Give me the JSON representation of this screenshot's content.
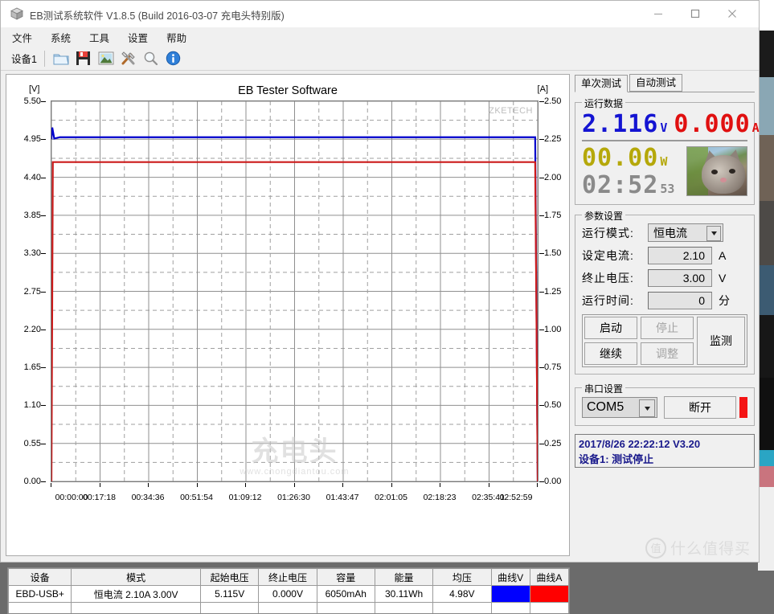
{
  "window": {
    "title": "EB测试系统软件 V1.8.5 (Build 2016-03-07 充电头特别版)",
    "minimize": "–",
    "maximize": "□",
    "close": "×"
  },
  "menu": {
    "items": [
      "文件",
      "系统",
      "工具",
      "设置",
      "帮助"
    ]
  },
  "toolbar": {
    "device_label": "设备1",
    "icons": [
      "open-folder-icon",
      "save-floppy-icon",
      "image-icon",
      "tools-icon",
      "zoom-icon",
      "info-icon"
    ]
  },
  "tabs": [
    {
      "label": "单次测试",
      "active": true
    },
    {
      "label": "自动测试",
      "active": false
    }
  ],
  "readout": {
    "group_title": "运行数据",
    "voltage": "2.116",
    "voltage_unit": "V",
    "current": "0.000",
    "current_unit": "A",
    "power": "00.00",
    "power_unit": "W",
    "time": "02:52",
    "time_unit": "53",
    "colors": {
      "voltage": "#1414d2",
      "current": "#e01010",
      "power": "#b5a80a",
      "time": "#8a8a8a"
    }
  },
  "params": {
    "group_title": "参数设置",
    "mode_label": "运行模式:",
    "mode_value": "恒电流",
    "current_label": "设定电流:",
    "current_value": "2.10",
    "current_unit": "A",
    "cutoff_label": "终止电压:",
    "cutoff_value": "3.00",
    "cutoff_unit": "V",
    "runtime_label": "运行时间:",
    "runtime_value": "0",
    "runtime_unit": "分",
    "buttons": [
      {
        "label": "启动",
        "disabled": false
      },
      {
        "label": "停止",
        "disabled": true
      },
      {
        "label": "继续",
        "disabled": false
      },
      {
        "label": "调整",
        "disabled": true
      }
    ],
    "monitor_label": "监测"
  },
  "serial": {
    "group_title": "串口设置",
    "port": "COM5",
    "disconnect_label": "断开",
    "led_color": "#f41414"
  },
  "log": {
    "line1": "2017/8/26 22:22:12  V3.20",
    "line2": "设备1: 测试停止"
  },
  "table": {
    "headers": [
      "设备",
      "模式",
      "起始电压",
      "终止电压",
      "容量",
      "能量",
      "均压",
      "曲线V",
      "曲线A"
    ],
    "rows": [
      {
        "device": "EBD-USB+",
        "mode": "恒电流  2.10A  3.00V",
        "start_v": "5.115V",
        "end_v": "0.000V",
        "capacity": "6050mAh",
        "energy": "30.11Wh",
        "avg_v": "4.98V",
        "curve_v_color": "#0000ff",
        "curve_a_color": "#ff0000"
      }
    ]
  },
  "watermarks": {
    "chart_corner": "ZKETECH",
    "center_big": "充电头",
    "center_url": "www.chongdiantou.com",
    "smzdm_badge": "值",
    "smzdm_text": "什么值得买"
  },
  "chart_data": {
    "type": "line",
    "title": "EB Tester Software",
    "xlabel": "",
    "ylabel": "[V]",
    "y2label": "[A]",
    "ylim": [
      0.0,
      5.5
    ],
    "y2lim": [
      0.0,
      2.5
    ],
    "grid": true,
    "legend": "none",
    "yticks": [
      "0.00",
      "0.55",
      "1.10",
      "1.65",
      "2.20",
      "2.75",
      "3.30",
      "3.85",
      "4.40",
      "4.95",
      "5.50"
    ],
    "y2ticks": [
      "0.00",
      "0.25",
      "0.50",
      "0.75",
      "1.00",
      "1.25",
      "1.50",
      "1.75",
      "2.00",
      "2.25",
      "2.50"
    ],
    "xticks": [
      "00:00:00",
      "00:17:18",
      "00:34:36",
      "00:51:54",
      "01:09:12",
      "01:26:30",
      "01:43:47",
      "02:01:05",
      "02:18:23",
      "02:35:41",
      "02:52:59"
    ],
    "series": [
      {
        "name": "Voltage",
        "axis": "left",
        "color": "#0000cc",
        "unit": "V",
        "x": [
          0,
          0.3,
          1.0,
          3.0,
          20,
          60,
          100,
          140,
          165,
          171,
          172,
          172.5,
          172.9
        ],
        "values": [
          4.95,
          5.12,
          4.96,
          4.98,
          4.98,
          4.98,
          4.98,
          4.98,
          4.98,
          4.98,
          4.98,
          2.3,
          0.0
        ]
      },
      {
        "name": "Current",
        "axis": "right",
        "color": "#cc1a1a",
        "unit": "A",
        "x": [
          0,
          0.5,
          2.0,
          20,
          60,
          100,
          140,
          165,
          171,
          172,
          172.5,
          172.9
        ],
        "values": [
          0.0,
          2.1,
          2.1,
          2.1,
          2.1,
          2.1,
          2.1,
          2.1,
          2.1,
          2.1,
          1.0,
          0.0
        ]
      }
    ]
  }
}
